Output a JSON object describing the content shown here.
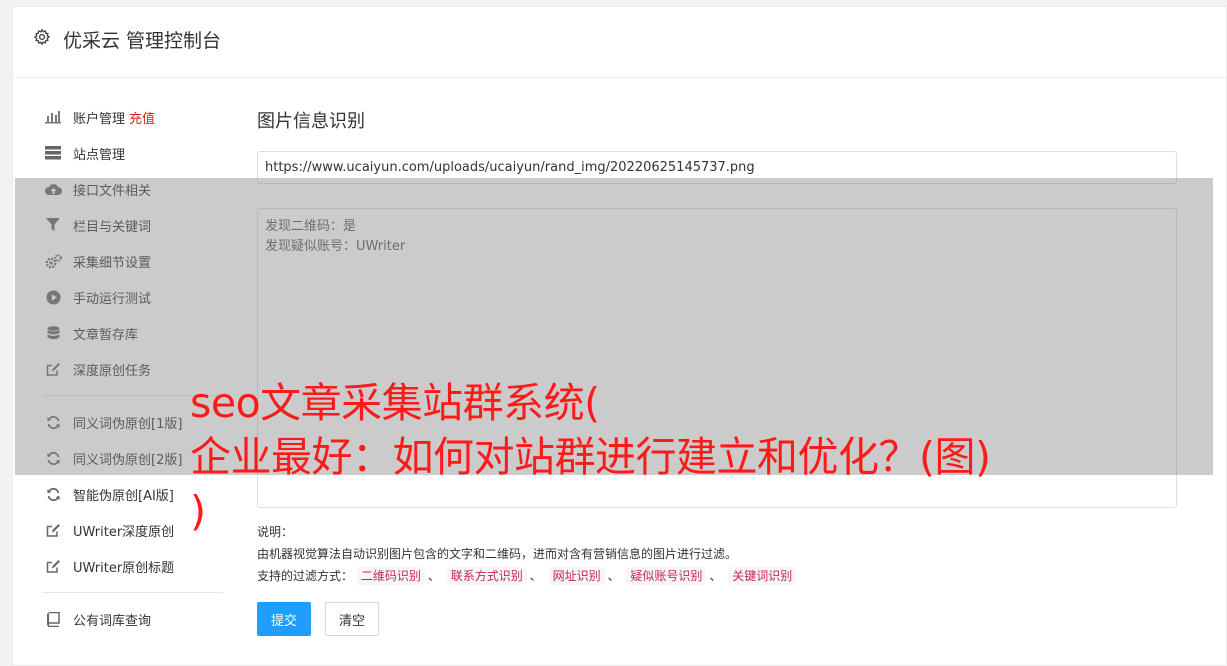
{
  "header": {
    "title": "优采云 管理控制台",
    "icon": "gear-icon"
  },
  "sidebar": {
    "group1": [
      {
        "label": "账户管理",
        "badge": "充值",
        "icon": "bar-chart-icon"
      },
      {
        "label": "站点管理",
        "icon": "server-icon"
      },
      {
        "label": "接口文件相关",
        "icon": "cloud-upload-icon"
      },
      {
        "label": "栏目与关键词",
        "icon": "filter-icon"
      },
      {
        "label": "采集细节设置",
        "icon": "cogs-icon"
      },
      {
        "label": "手动运行测试",
        "icon": "play-circle-icon"
      },
      {
        "label": "文章暂存库",
        "icon": "database-icon"
      },
      {
        "label": "深度原创任务",
        "icon": "edit-icon"
      }
    ],
    "group2": [
      {
        "label": "同义词伪原创[1版]",
        "icon": "refresh-icon"
      },
      {
        "label": "同义词伪原创[2版]",
        "icon": "refresh-icon"
      },
      {
        "label": "智能伪原创[AI版]",
        "icon": "refresh-icon"
      },
      {
        "label": "UWriter深度原创",
        "icon": "edit-icon"
      },
      {
        "label": "UWriter原创标题",
        "icon": "edit-icon"
      }
    ],
    "group3": [
      {
        "label": "公有词库查询",
        "icon": "book-icon"
      }
    ]
  },
  "main": {
    "heading": "图片信息识别",
    "url_value": "https://www.ucaiyun.com/uploads/ucaiyun/rand_img/20220625145737.png",
    "result_lines": [
      "发现二维码：是",
      "发现疑似账号：UWriter"
    ],
    "desc_title": "说明：",
    "desc_text": "由机器视觉算法自动识别图片包含的文字和二维码，进而对含有营销信息的图片进行过滤。",
    "filter_label": "支持的过滤方式：",
    "filters": [
      "二维码识别",
      "联系方式识别",
      "网址识别",
      "疑似账号识别",
      "关键词识别"
    ],
    "filter_sep": "、",
    "submit_label": "提交",
    "clear_label": "清空"
  },
  "overlay": {
    "line1": "seo文章采集站群系统(",
    "line2": "企业最好：如何对站群进行建立和优化？(图)",
    "line3": ")"
  }
}
